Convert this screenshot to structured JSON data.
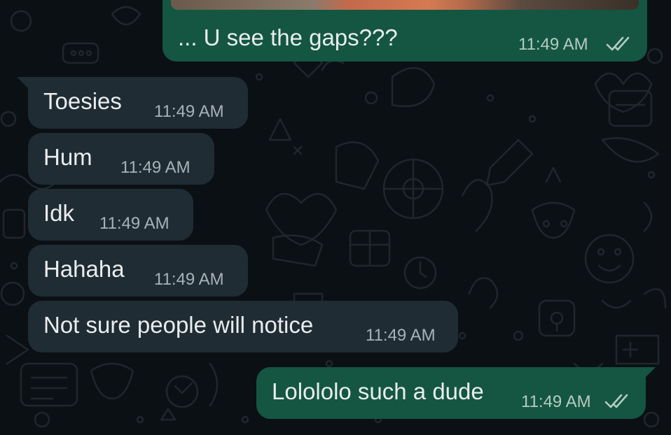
{
  "chat": {
    "messages": [
      {
        "direction": "outgoing",
        "text": "... U see the gaps???",
        "time": "11:49 AM",
        "status_icon": "double-check-icon",
        "has_photo_above": true
      },
      {
        "direction": "incoming",
        "text": "Toesies",
        "time": "11:49 AM"
      },
      {
        "direction": "incoming",
        "text": "Hum",
        "time": "11:49 AM"
      },
      {
        "direction": "incoming",
        "text": "Idk",
        "time": "11:49 AM"
      },
      {
        "direction": "incoming",
        "text": "Hahaha",
        "time": "11:49 AM"
      },
      {
        "direction": "incoming",
        "text": "Not sure people will notice",
        "time": "11:49 AM"
      },
      {
        "direction": "outgoing",
        "text": "Lolololo such a dude",
        "time": "11:49 AM",
        "status_icon": "double-check-icon"
      }
    ]
  },
  "colors": {
    "background": "#0b1014",
    "incoming_bubble": "#202c33",
    "outgoing_bubble": "#145641",
    "text": "#e9edef",
    "timestamp": "#a7b2b9"
  }
}
